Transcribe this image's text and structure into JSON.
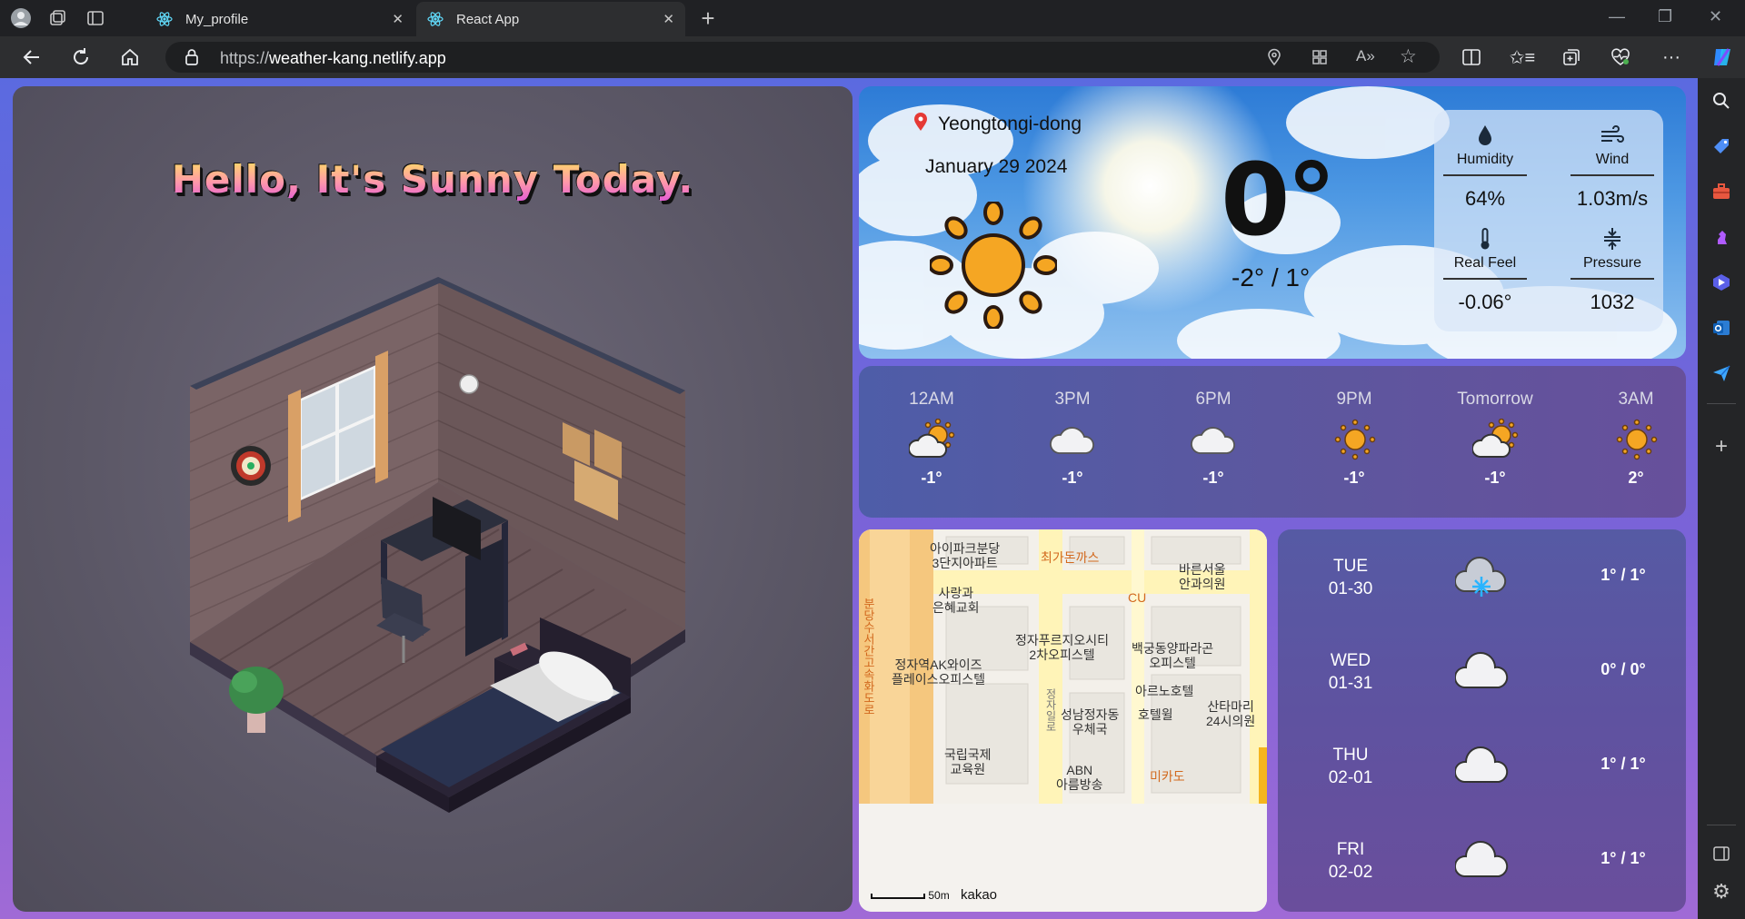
{
  "browser": {
    "tabs": [
      {
        "title": "My_profile",
        "active": false
      },
      {
        "title": "React App",
        "active": true
      }
    ],
    "url_scheme": "https://",
    "url_host": "weather-kang.netlify.app",
    "accent": "#2d2e30"
  },
  "room": {
    "greeting": "Hello, It's Sunny Today."
  },
  "current": {
    "location": "Yeongtongi-dong",
    "date": "January 29 2024",
    "temperature": "0°",
    "range": "-2° / 1°",
    "icon": "sun-icon",
    "stats": [
      {
        "label": "Humidity",
        "value": "64%",
        "icon": "droplet-icon"
      },
      {
        "label": "Wind",
        "value": "1.03m/s",
        "icon": "wind-icon"
      },
      {
        "label": "Real Feel",
        "value": "-0.06°",
        "icon": "thermometer-icon"
      },
      {
        "label": "Pressure",
        "value": "1032",
        "icon": "pressure-icon"
      }
    ]
  },
  "hourly": [
    {
      "time": "12AM",
      "temp": "-1°",
      "icon": "partly-cloudy-icon"
    },
    {
      "time": "3PM",
      "temp": "-1°",
      "icon": "cloud-icon"
    },
    {
      "time": "6PM",
      "temp": "-1°",
      "icon": "cloud-icon"
    },
    {
      "time": "9PM",
      "temp": "-1°",
      "icon": "sun-icon"
    },
    {
      "time": "Tomorrow",
      "temp": "-1°",
      "icon": "partly-cloudy-icon"
    },
    {
      "time": "3AM",
      "temp": "2°",
      "icon": "sun-icon"
    }
  ],
  "map": {
    "labels": [
      {
        "text": "아이파크분당\n3단지아파트",
        "orange": false
      },
      {
        "text": "최가돈까스",
        "orange": true
      },
      {
        "text": "바른서울\n안과의원",
        "orange": false
      },
      {
        "text": "사랑과\n은혜교회",
        "orange": false
      },
      {
        "text": "CU",
        "orange": true
      },
      {
        "text": "정자푸르지오시티\n2차오피스텔",
        "orange": false
      },
      {
        "text": "백궁동양파라곤\n오피스텔",
        "orange": false
      },
      {
        "text": "정자역AK와이즈\n플레이스오피스텔",
        "orange": false
      },
      {
        "text": "아르노호텔",
        "orange": false
      },
      {
        "text": "성남정자동\n우체국",
        "orange": false
      },
      {
        "text": "호텔윌",
        "orange": false
      },
      {
        "text": "산타마리\n24시의원",
        "orange": false
      },
      {
        "text": "국립국제\n교육원",
        "orange": false
      },
      {
        "text": "미카도",
        "orange": true
      },
      {
        "text": "ABN\n아름방송",
        "orange": false
      },
      {
        "text": "분당수서간고속화도로",
        "orange": true
      },
      {
        "text": "정자일로",
        "orange": false
      }
    ],
    "scale": "50m",
    "provider": "kakao"
  },
  "forecast": [
    {
      "day": "TUE",
      "date": "01-30",
      "temp": "1° / 1°",
      "icon": "snow-cloud-icon"
    },
    {
      "day": "WED",
      "date": "01-31",
      "temp": "0° / 0°",
      "icon": "cloud-icon"
    },
    {
      "day": "THU",
      "date": "02-01",
      "temp": "1° / 1°",
      "icon": "cloud-icon"
    },
    {
      "day": "FRI",
      "date": "02-02",
      "temp": "1° / 1°",
      "icon": "cloud-icon"
    }
  ]
}
